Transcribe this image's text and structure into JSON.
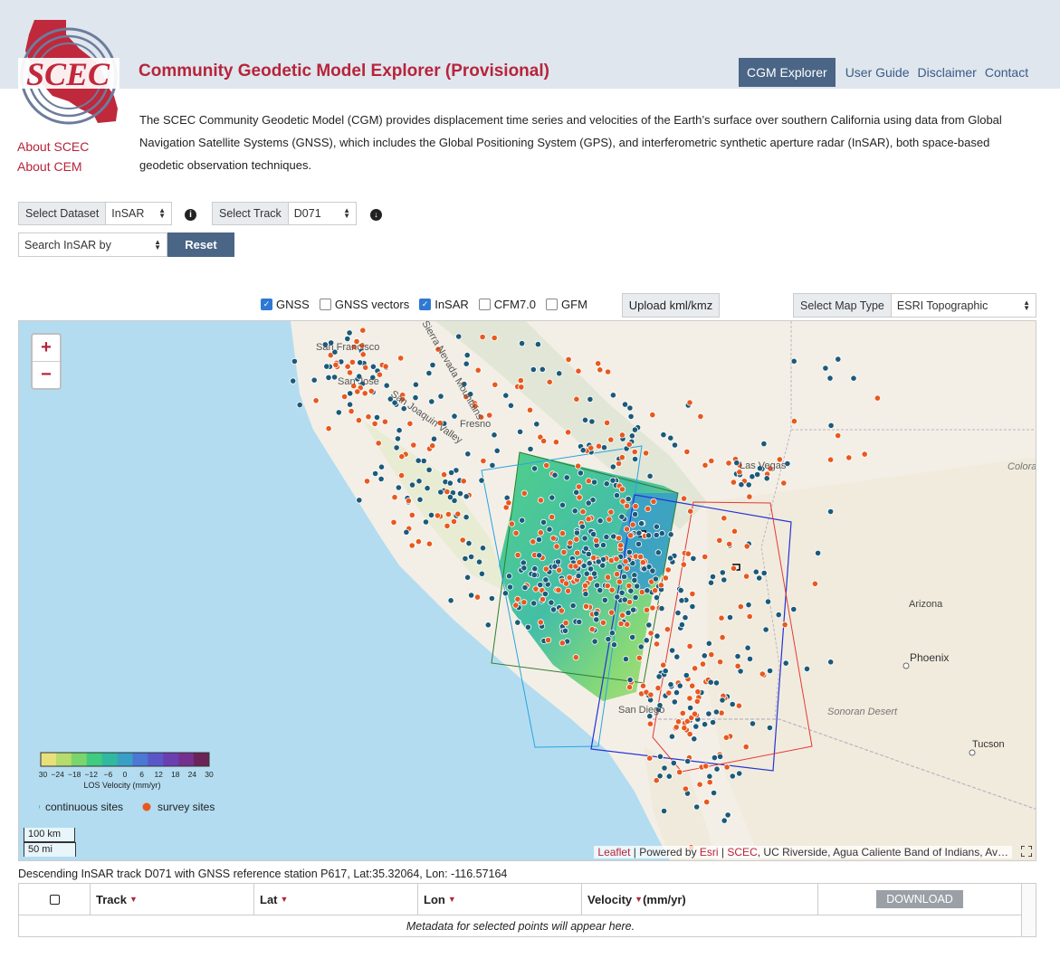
{
  "header": {
    "logo_text": "SCEC",
    "title": "Community Geodetic Model Explorer (Provisional)",
    "nav": [
      {
        "label": "CGM Explorer",
        "active": true
      },
      {
        "label": "User Guide",
        "active": false
      },
      {
        "label": "Disclaimer",
        "active": false
      },
      {
        "label": "Contact",
        "active": false
      }
    ]
  },
  "sidebar": {
    "links": [
      "About SCEC",
      "About CEM"
    ]
  },
  "intro_text": "The SCEC Community Geodetic Model (CGM) provides displacement time series and velocities of the Earth’s surface over southern California using data from Global Navigation Satellite Systems (GNSS), which includes the Global Positioning System (GPS), and interferometric synthetic aperture radar (InSAR), both space-based geodetic observation techniques.",
  "controls": {
    "dataset_label": "Select Dataset",
    "dataset_value": "InSAR",
    "info_icon": "info-circle-icon",
    "track_label": "Select Track",
    "track_value": "D071",
    "download_icon": "download-circle-icon",
    "search_value": "Search InSAR by",
    "reset_label": "Reset"
  },
  "layers": {
    "items": [
      {
        "label": "GNSS",
        "checked": true
      },
      {
        "label": "GNSS vectors",
        "checked": false
      },
      {
        "label": "InSAR",
        "checked": true
      },
      {
        "label": "CFM7.0",
        "checked": false
      },
      {
        "label": "GFM",
        "checked": false
      }
    ],
    "upload_label": "Upload kml/kmz",
    "map_type_label": "Select Map Type",
    "map_type_value": "ESRI Topographic"
  },
  "map": {
    "zoom_in": "+",
    "zoom_out": "−",
    "place_labels": [
      "San Francisco",
      "San Jose",
      "San Joaquin Valley",
      "Fresno",
      "Sierra Nevada Mountains",
      "Las Vegas",
      "Colorado Plateau",
      "Arizona",
      "Phoenix",
      "Sonoran Desert",
      "Tucson",
      "San Diego"
    ],
    "legend": {
      "ticks": [
        "−30",
        "−24",
        "−18",
        "−12",
        "−6",
        "0",
        "6",
        "12",
        "18",
        "24",
        "30"
      ],
      "title": "LOS Velocity (mm/yr)",
      "gradient_colors": [
        "#e8e07a",
        "#b6dc6e",
        "#7ad66c",
        "#3fcc7e",
        "#30b9a0",
        "#3a9fc6",
        "#4a78d4",
        "#5a58c8",
        "#6a3fb0",
        "#74318e",
        "#6a2455"
      ],
      "continuous_label": "continuous sites",
      "survey_label": "survey sites",
      "continuous_color": "#1b5a7a",
      "survey_color": "#e8581f"
    },
    "scale_km": "100 km",
    "scale_mi": "50 mi",
    "attribution": {
      "leaflet": "Leaflet",
      "powered": " | Powered by ",
      "esri": "Esri",
      "sep": " | ",
      "scec": "SCEC",
      "rest": ", UC Riverside, Agua Caliente Band of Indians, Av…"
    }
  },
  "caption": "Descending InSAR track D071 with GNSS reference station P617, Lat:35.32064, Lon: -116.57164",
  "table": {
    "columns": [
      "Track",
      "Lat",
      "Lon",
      "Velocity"
    ],
    "velocity_unit": "(mm/yr)",
    "download_label": "DOWNLOAD",
    "empty_message": "Metadata for selected points will appear here."
  }
}
